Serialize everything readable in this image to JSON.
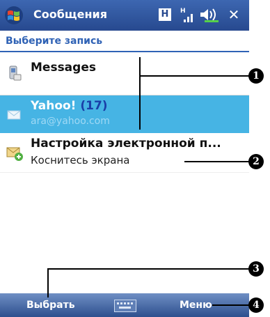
{
  "titlebar": {
    "title": "Сообщения",
    "status_h": "H"
  },
  "header": {
    "label": "Выберите запись"
  },
  "list": {
    "items": [
      {
        "title": "Messages",
        "subtitle": ""
      },
      {
        "title": "Yahoo!",
        "count": "(17)",
        "subtitle": "ara@yahoo.com"
      },
      {
        "title": "Настройка электронной п...",
        "subtitle": "Коснитесь экрана"
      }
    ]
  },
  "bottombar": {
    "left_softkey": "Выбрать",
    "right_softkey": "Меню"
  },
  "callouts": [
    "1",
    "2",
    "3",
    "4"
  ],
  "colors": {
    "title_bar": "#27498f",
    "header_text": "#2f62b5",
    "selected_row": "#46b4e4",
    "yahoo_count": "#1a3fa8"
  },
  "icons": {
    "start": "windows-flag-icon",
    "signal": "signal-strength-icon",
    "volume": "speaker-volume-icon",
    "close": "close-x-icon",
    "messages": "messages-device-icon",
    "yahoo": "envelope-icon",
    "setup": "email-setup-icon",
    "keyboard": "keyboard-icon"
  }
}
